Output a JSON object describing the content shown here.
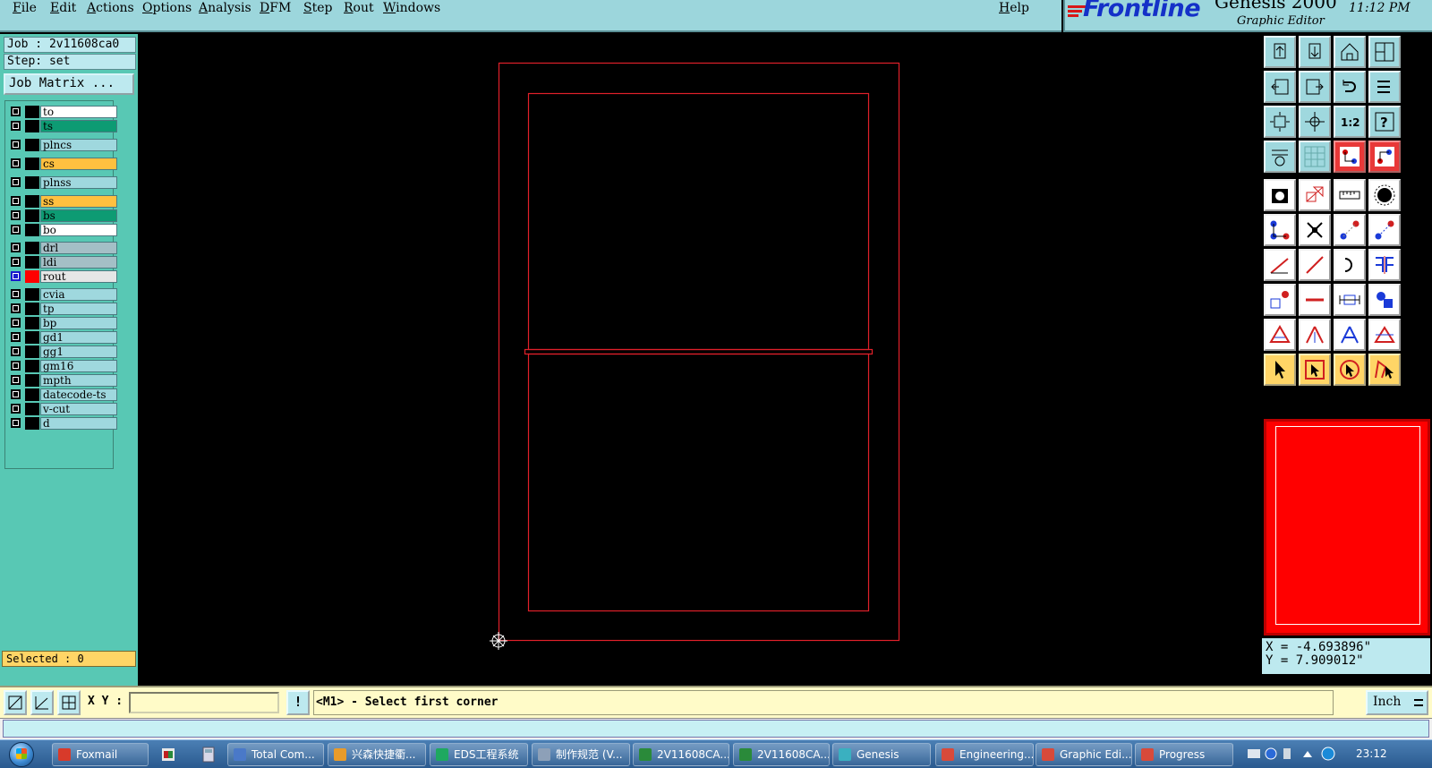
{
  "menu": {
    "items": [
      "File",
      "Edit",
      "Actions",
      "Options",
      "Analysis",
      "DFM",
      "Step",
      "Rout",
      "Windows"
    ],
    "help": "Help"
  },
  "brand": {
    "logo": "Frontline",
    "product": "Genesis 2000",
    "subtitle": "Graphic Editor",
    "time": "11:12 PM"
  },
  "job": {
    "job_line": "Job : 2v11608ca0",
    "step_line": "Step: set",
    "matrix_button": "Job Matrix ..."
  },
  "layers": [
    {
      "name": "to",
      "color": "#ffffff",
      "active": false
    },
    {
      "name": "ts",
      "color": "#0d9b73",
      "active": false
    },
    {
      "name": "plncs",
      "color": "#9fd8de",
      "active": false
    },
    {
      "name": "cs",
      "color": "#ffc040",
      "active": false
    },
    {
      "name": "plnss",
      "color": "#9fd8de",
      "active": false
    },
    {
      "name": "ss",
      "color": "#ffc040",
      "active": false
    },
    {
      "name": "bs",
      "color": "#0d9b73",
      "active": false
    },
    {
      "name": "bo",
      "color": "#ffffff",
      "active": false
    },
    {
      "name": "drl",
      "color": "#a4bfc6",
      "active": false
    },
    {
      "name": "ldi",
      "color": "#a4bfc6",
      "active": false
    },
    {
      "name": "rout",
      "color": "#e6e6e6",
      "active": true
    },
    {
      "name": "cvia",
      "color": "#9fd8de",
      "active": false
    },
    {
      "name": "tp",
      "color": "#9fd8de",
      "active": false
    },
    {
      "name": "bp",
      "color": "#9fd8de",
      "active": false
    },
    {
      "name": "gd1",
      "color": "#9fd8de",
      "active": false
    },
    {
      "name": "gg1",
      "color": "#9fd8de",
      "active": false
    },
    {
      "name": "gm16",
      "color": "#9fd8de",
      "active": false
    },
    {
      "name": "mpth",
      "color": "#9fd8de",
      "active": false
    },
    {
      "name": "datecode-ts",
      "color": "#9fd8de",
      "active": false
    },
    {
      "name": "v-cut",
      "color": "#9fd8de",
      "active": false
    },
    {
      "name": "d",
      "color": "#9fd8de",
      "active": false
    }
  ],
  "selected": "Selected : 0",
  "toolbar": {
    "icons": [
      "open-step-icon",
      "save-icon",
      "home-icon",
      "split-view-icon",
      "pan-left-icon",
      "pan-right-icon",
      "undo-view-icon",
      "redraw-icon",
      "fit-icon",
      "center-icon",
      "scale-1-2-icon",
      "help-icon",
      "snap-icon",
      "grid-icon",
      "layer-compare-icon",
      "layer-compare-alt-icon",
      "photo-icon",
      "shapes-icon",
      "measure-icon",
      "pad-icon",
      "connect-icon",
      "delete-node-icon",
      "line-node-icon",
      "move-node-icon",
      "angle-icon",
      "line-icon",
      "arc-icon",
      "mirror-icon",
      "drop-icon",
      "horizontal-line-icon",
      "dimension-icon",
      "copy-shapes-icon",
      "triangle-a-icon",
      "triangle-b-icon",
      "triangle-c-icon",
      "triangle-d-icon",
      "select-arrow-icon",
      "select-box-icon",
      "select-circle-icon",
      "select-path-icon"
    ]
  },
  "coords": {
    "x": "X = -4.693896\"",
    "y": "Y = 7.909012\""
  },
  "command": {
    "xy_label": "X Y :",
    "xy_value": "",
    "bang": "!",
    "prompt": "<M1> - Select first corner",
    "units": "Inch"
  },
  "canvas": {
    "outline_color": "#e0202a"
  },
  "taskbar": {
    "tasks": [
      {
        "label": "Foxmail",
        "color": "#d83a2a"
      },
      {
        "label": "Total Com...",
        "color": "#4a79c8"
      },
      {
        "label": "兴森快捷衢...",
        "color": "#e89b2a"
      },
      {
        "label": "EDS工程系统",
        "color": "#1ea860"
      },
      {
        "label": "制作规范 (V...",
        "color": "#8da0b8"
      },
      {
        "label": "2V11608CA...",
        "color": "#2a8a3a"
      },
      {
        "label": "2V11608CA...",
        "color": "#2a8a3a"
      },
      {
        "label": "Genesis",
        "color": "#3ab0c0"
      },
      {
        "label": "Engineering...",
        "color": "#d84a3a"
      },
      {
        "label": "Graphic Edi...",
        "color": "#d84a3a"
      },
      {
        "label": "Progress",
        "color": "#d84a3a"
      }
    ],
    "clock": "23:12"
  }
}
